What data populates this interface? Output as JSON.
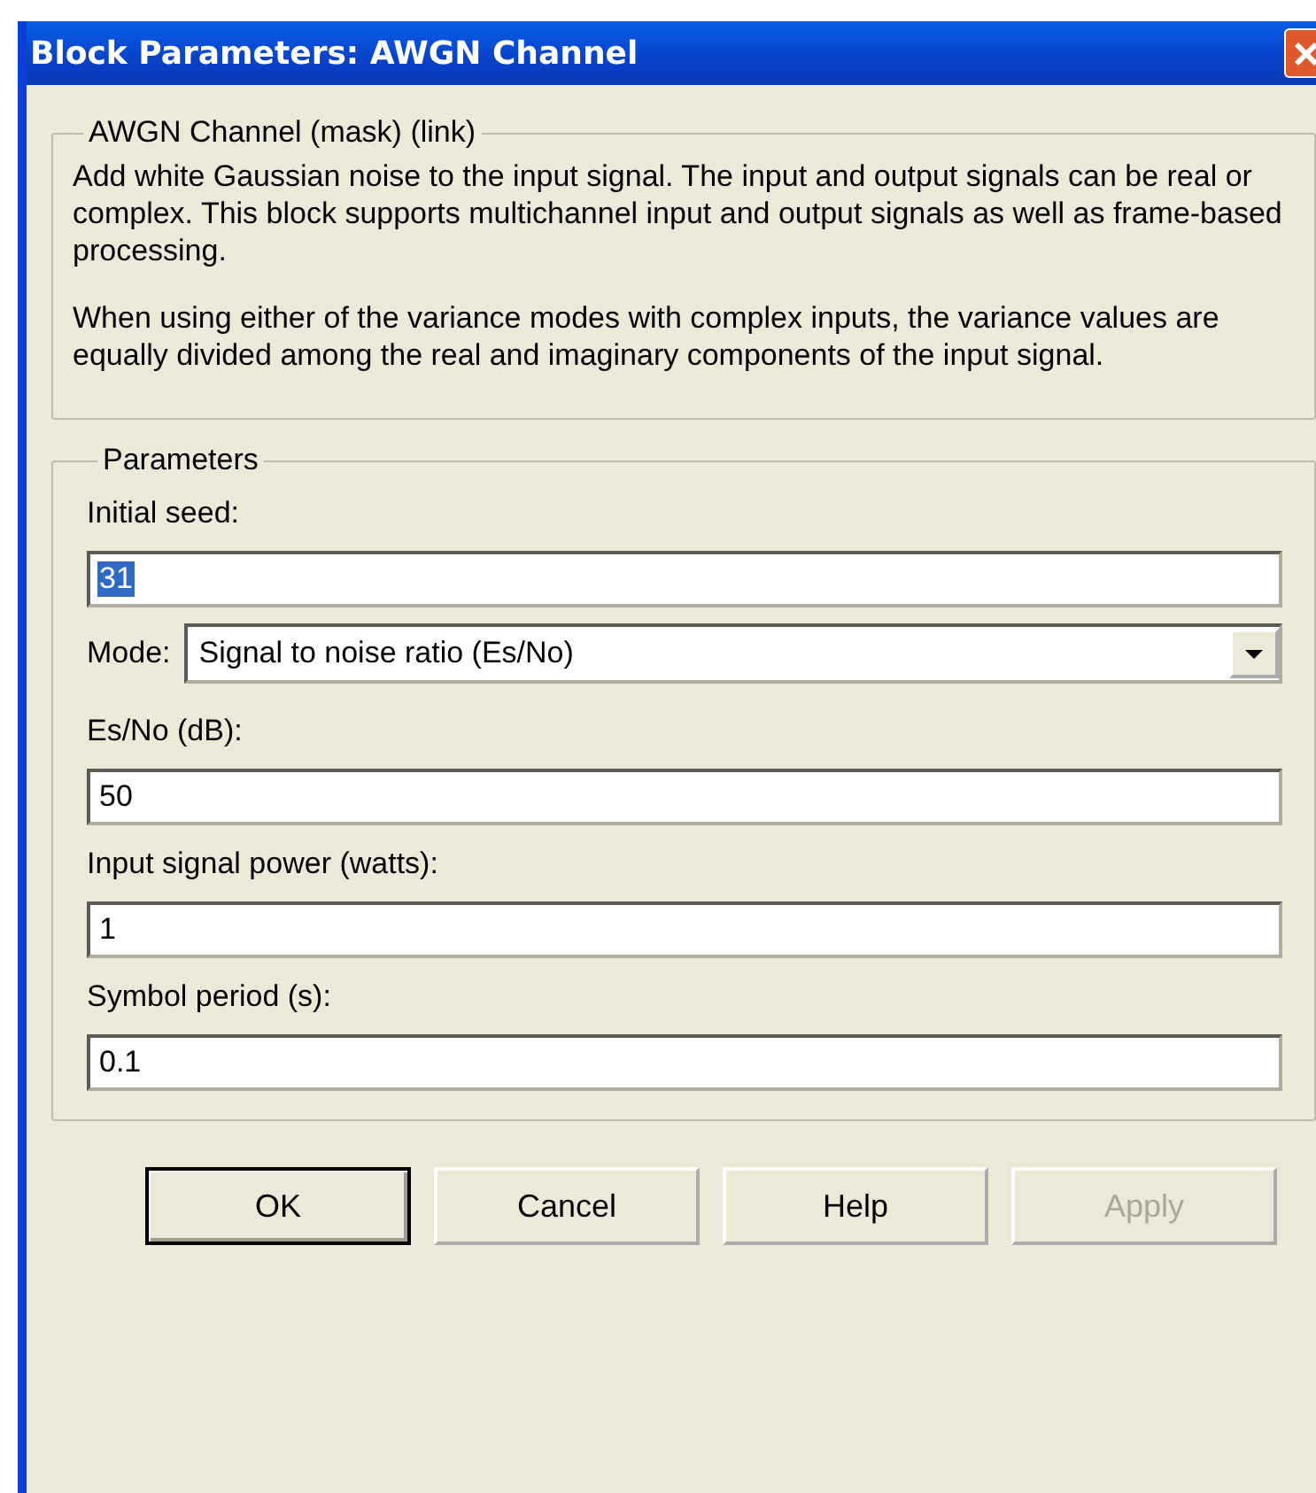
{
  "window": {
    "title": "Block Parameters: AWGN Channel"
  },
  "description": {
    "title": "AWGN Channel (mask) (link)",
    "paragraphs": [
      "Add white Gaussian noise to the input signal. The input and output signals can be real or complex. This block supports multichannel input and output signals as well as frame-based processing.",
      "When using either of the variance modes with complex inputs, the variance values are equally divided among the real and imaginary components of the input signal."
    ]
  },
  "parameters": {
    "title": "Parameters",
    "fields": [
      {
        "kind": "text",
        "label": "Initial seed:",
        "value": "31",
        "selected": true
      },
      {
        "kind": "dropdown",
        "label": "Mode:",
        "value": "Signal to noise ratio  (Es/No)",
        "selected": false
      },
      {
        "kind": "text",
        "label": "Es/No (dB):",
        "value": "50",
        "selected": false
      },
      {
        "kind": "text",
        "label": "Input signal power (watts):",
        "value": "1",
        "selected": false
      },
      {
        "kind": "text",
        "label": "Symbol period (s):",
        "value": "0.1",
        "selected": false
      }
    ]
  },
  "buttons": [
    {
      "label": "OK",
      "default": true,
      "disabled": false
    },
    {
      "label": "Cancel",
      "default": false,
      "disabled": false
    },
    {
      "label": "Help",
      "default": false,
      "disabled": false
    },
    {
      "label": "Apply",
      "default": false,
      "disabled": true
    }
  ]
}
